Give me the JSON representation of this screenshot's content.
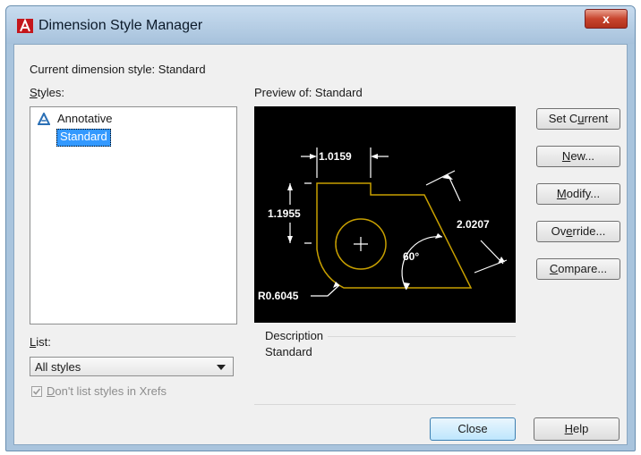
{
  "window": {
    "title": "Dimension Style Manager",
    "close_glyph": "x"
  },
  "current_style": {
    "label": "Current dimension style:",
    "value": "Standard"
  },
  "styles": {
    "label_underlined": "S",
    "label_rest": "tyles:",
    "items": [
      {
        "label": "Annotative",
        "icon": "annotative-icon",
        "selected": false
      },
      {
        "label": "Standard",
        "selected": true
      }
    ]
  },
  "list": {
    "label_underlined": "L",
    "label_rest": "ist:",
    "selected_value": "All styles",
    "xrefs_checkbox": {
      "prefix": "",
      "underlined": "D",
      "rest": "on't list styles in Xrefs",
      "checked": true,
      "enabled": false
    }
  },
  "preview": {
    "label": "Preview of: Standard",
    "dims": {
      "top": "1.0159",
      "left": "1.1955",
      "diagonal": "2.0207",
      "angle": "60°",
      "radius": "R0.6045"
    }
  },
  "description": {
    "label": "Description",
    "value": "Standard"
  },
  "buttons": {
    "set_current": {
      "prefix": "Set C",
      "underlined": "u",
      "rest": "rrent"
    },
    "new": {
      "prefix": "",
      "underlined": "N",
      "rest": "ew..."
    },
    "modify": {
      "prefix": "",
      "underlined": "M",
      "rest": "odify..."
    },
    "override": {
      "prefix": "Ov",
      "underlined": "e",
      "rest": "rride..."
    },
    "compare": {
      "prefix": "",
      "underlined": "C",
      "rest": "ompare..."
    },
    "close": {
      "label": "Close"
    },
    "help": {
      "prefix": "",
      "underlined": "H",
      "rest": "elp"
    }
  },
  "colors": {
    "selection": "#3399ff",
    "preview_geometry": "#c8a000",
    "preview_dims": "#ffffff",
    "close_button": "#c8452e"
  }
}
